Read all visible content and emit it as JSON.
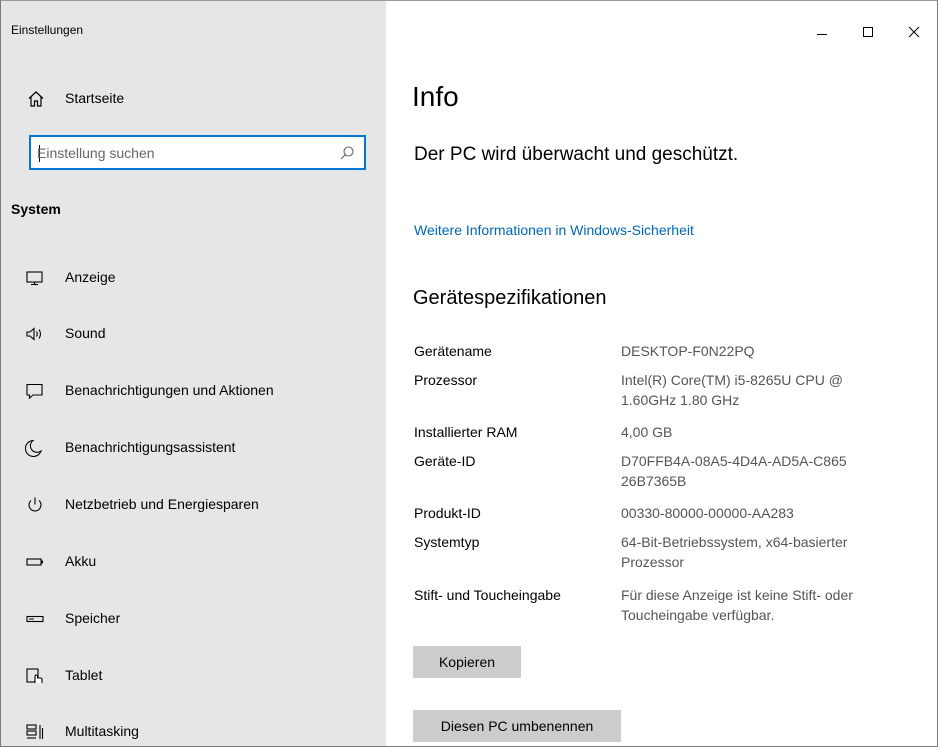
{
  "window": {
    "title": "Einstellungen",
    "controls": {
      "minimize_icon": "minimize-icon",
      "maximize_icon": "maximize-icon",
      "close_icon": "close-icon"
    }
  },
  "sidebar": {
    "home_label": "Startseite",
    "search": {
      "placeholder": "Einstellung suchen",
      "value": ""
    },
    "section_title": "System",
    "items": [
      {
        "label": "Anzeige",
        "icon": "display-icon"
      },
      {
        "label": "Sound",
        "icon": "sound-icon"
      },
      {
        "label": "Benachrichtigungen und Aktionen",
        "icon": "notifications-icon"
      },
      {
        "label": "Benachrichtigungsassistent",
        "icon": "focus-assist-icon"
      },
      {
        "label": "Netzbetrieb und Energiesparen",
        "icon": "power-icon"
      },
      {
        "label": "Akku",
        "icon": "battery-icon"
      },
      {
        "label": "Speicher",
        "icon": "storage-icon"
      },
      {
        "label": "Tablet",
        "icon": "tablet-icon"
      },
      {
        "label": "Multitasking",
        "icon": "multitasking-icon"
      }
    ]
  },
  "main": {
    "title": "Info",
    "status": "Der PC wird überwacht und geschützt.",
    "security_link": "Weitere Informationen in Windows-Sicherheit",
    "spec_title": "Gerätespezifikationen",
    "specs": [
      {
        "key": "Gerätename",
        "value": "DESKTOP-F0N22PQ"
      },
      {
        "key": "Prozessor",
        "value": "Intel(R) Core(TM) i5-8265U CPU @ 1.60GHz   1.80 GHz"
      },
      {
        "key": "Installierter RAM",
        "value": "4,00 GB"
      },
      {
        "key": "Geräte-ID",
        "value": "D70FFB4A-08A5-4D4A-AD5A-C86526B7365B"
      },
      {
        "key": "Produkt-ID",
        "value": "00330-80000-00000-AA283"
      },
      {
        "key": "Systemtyp",
        "value": "64-Bit-Betriebssystem, x64-basierter Prozessor"
      },
      {
        "key": "Stift- und Toucheingabe",
        "value": "Für diese Anzeige ist keine Stift- oder Toucheingabe verfügbar."
      }
    ],
    "copy_button": "Kopieren",
    "rename_button": "Diesen PC umbenennen"
  },
  "colors": {
    "sidebar_bg": "#e6e6e6",
    "accent": "#0078d7",
    "link": "#0067b8",
    "button_bg": "#cccccc"
  }
}
